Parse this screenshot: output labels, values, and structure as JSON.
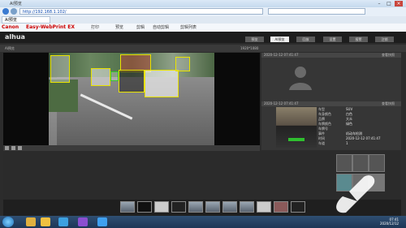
{
  "browser": {
    "title": "AI预览",
    "address": "http://192.168.1.102/",
    "tab": "AI预览",
    "menu": [
      "打印",
      "预览",
      "剪辑",
      "自动剪辑",
      "剪辑列表"
    ],
    "canon": "Canon",
    "easy": "Easy-WebPrint EX"
  },
  "app": {
    "brand": "alhua",
    "nav": [
      {
        "label": "预览",
        "active": false
      },
      {
        "label": "AI预览",
        "active": true
      },
      {
        "label": "回放",
        "active": false
      },
      {
        "label": "设置",
        "active": false
      },
      {
        "label": "报警",
        "active": false
      },
      {
        "label": "注销",
        "active": false
      }
    ],
    "video_label": "AI预览",
    "video_res": "1920*1080",
    "panel1_time": "2020-12-12 07:41:47",
    "panel1_action": "查看快照",
    "panel2_time": "2020-12-12 07:41:47",
    "panel2_action": "查看快照",
    "vehicle_fields": [
      {
        "k": "车型",
        "v": "SUV"
      },
      {
        "k": "车身颜色",
        "v": "白色"
      },
      {
        "k": "品牌",
        "v": "大众"
      },
      {
        "k": "车牌颜色",
        "v": "绿色"
      },
      {
        "k": "车牌号",
        "v": ""
      },
      {
        "k": "事件",
        "v": "机动车检测"
      },
      {
        "k": "时间",
        "v": "2020-12-12 07:41:47"
      },
      {
        "k": "车道",
        "v": "1"
      }
    ]
  },
  "taskbar": {
    "time": "07:41",
    "date": "2020/12/12"
  },
  "colors": {
    "box_yellow": "#e9e300",
    "box_green": "#36c82f",
    "dark": "#2c2c2c"
  }
}
